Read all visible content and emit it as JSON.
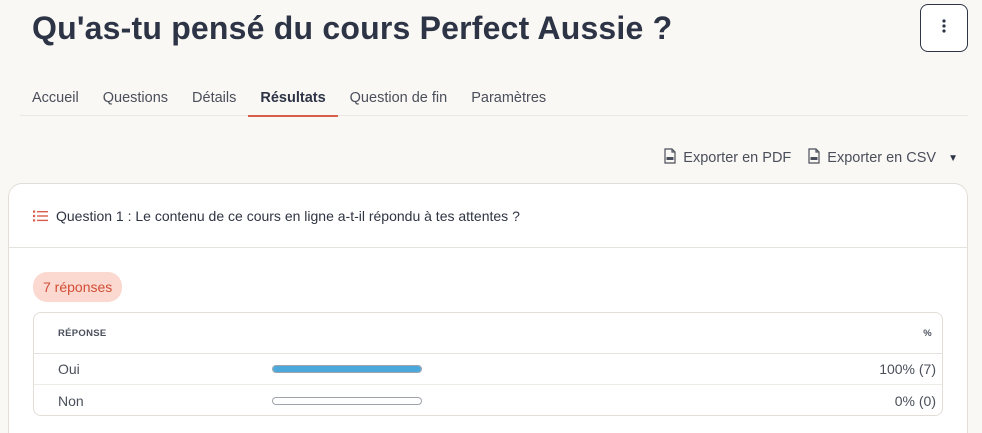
{
  "page": {
    "title": "Qu'as-tu pensé du cours Perfect Aussie ?"
  },
  "tabs": [
    {
      "label": "Accueil",
      "active": false
    },
    {
      "label": "Questions",
      "active": false
    },
    {
      "label": "Détails",
      "active": false
    },
    {
      "label": "Résultats",
      "active": true
    },
    {
      "label": "Question de fin",
      "active": false
    },
    {
      "label": "Paramètres",
      "active": false
    }
  ],
  "export": {
    "pdf_label": "Exporter en PDF",
    "csv_label": "Exporter en CSV"
  },
  "question": {
    "text": "Question 1 : Le contenu de ce cours en ligne a-t-il répondu à tes attentes ?",
    "responses_badge": "7 réponses",
    "table": {
      "col_response": "RÉPONSE",
      "col_percent": "%",
      "rows": [
        {
          "label": "Oui",
          "fraction": 1.0,
          "value": "100% (7)"
        },
        {
          "label": "Non",
          "fraction": 0.0,
          "value": "0% (0)"
        }
      ]
    }
  },
  "colors": {
    "accent": "#d7604a",
    "bar": "#4aa8dc",
    "badge_bg": "#fbd9d1"
  }
}
